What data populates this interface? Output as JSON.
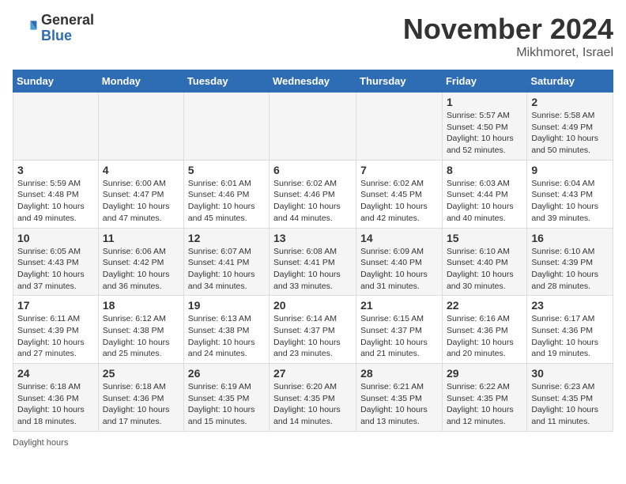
{
  "logo": {
    "general": "General",
    "blue": "Blue"
  },
  "header": {
    "month": "November 2024",
    "location": "Mikhmoret, Israel"
  },
  "days_of_week": [
    "Sunday",
    "Monday",
    "Tuesday",
    "Wednesday",
    "Thursday",
    "Friday",
    "Saturday"
  ],
  "weeks": [
    [
      {
        "day": "",
        "info": ""
      },
      {
        "day": "",
        "info": ""
      },
      {
        "day": "",
        "info": ""
      },
      {
        "day": "",
        "info": ""
      },
      {
        "day": "",
        "info": ""
      },
      {
        "day": "1",
        "info": "Sunrise: 5:57 AM\nSunset: 4:50 PM\nDaylight: 10 hours and 52 minutes."
      },
      {
        "day": "2",
        "info": "Sunrise: 5:58 AM\nSunset: 4:49 PM\nDaylight: 10 hours and 50 minutes."
      }
    ],
    [
      {
        "day": "3",
        "info": "Sunrise: 5:59 AM\nSunset: 4:48 PM\nDaylight: 10 hours and 49 minutes."
      },
      {
        "day": "4",
        "info": "Sunrise: 6:00 AM\nSunset: 4:47 PM\nDaylight: 10 hours and 47 minutes."
      },
      {
        "day": "5",
        "info": "Sunrise: 6:01 AM\nSunset: 4:46 PM\nDaylight: 10 hours and 45 minutes."
      },
      {
        "day": "6",
        "info": "Sunrise: 6:02 AM\nSunset: 4:46 PM\nDaylight: 10 hours and 44 minutes."
      },
      {
        "day": "7",
        "info": "Sunrise: 6:02 AM\nSunset: 4:45 PM\nDaylight: 10 hours and 42 minutes."
      },
      {
        "day": "8",
        "info": "Sunrise: 6:03 AM\nSunset: 4:44 PM\nDaylight: 10 hours and 40 minutes."
      },
      {
        "day": "9",
        "info": "Sunrise: 6:04 AM\nSunset: 4:43 PM\nDaylight: 10 hours and 39 minutes."
      }
    ],
    [
      {
        "day": "10",
        "info": "Sunrise: 6:05 AM\nSunset: 4:43 PM\nDaylight: 10 hours and 37 minutes."
      },
      {
        "day": "11",
        "info": "Sunrise: 6:06 AM\nSunset: 4:42 PM\nDaylight: 10 hours and 36 minutes."
      },
      {
        "day": "12",
        "info": "Sunrise: 6:07 AM\nSunset: 4:41 PM\nDaylight: 10 hours and 34 minutes."
      },
      {
        "day": "13",
        "info": "Sunrise: 6:08 AM\nSunset: 4:41 PM\nDaylight: 10 hours and 33 minutes."
      },
      {
        "day": "14",
        "info": "Sunrise: 6:09 AM\nSunset: 4:40 PM\nDaylight: 10 hours and 31 minutes."
      },
      {
        "day": "15",
        "info": "Sunrise: 6:10 AM\nSunset: 4:40 PM\nDaylight: 10 hours and 30 minutes."
      },
      {
        "day": "16",
        "info": "Sunrise: 6:10 AM\nSunset: 4:39 PM\nDaylight: 10 hours and 28 minutes."
      }
    ],
    [
      {
        "day": "17",
        "info": "Sunrise: 6:11 AM\nSunset: 4:39 PM\nDaylight: 10 hours and 27 minutes."
      },
      {
        "day": "18",
        "info": "Sunrise: 6:12 AM\nSunset: 4:38 PM\nDaylight: 10 hours and 25 minutes."
      },
      {
        "day": "19",
        "info": "Sunrise: 6:13 AM\nSunset: 4:38 PM\nDaylight: 10 hours and 24 minutes."
      },
      {
        "day": "20",
        "info": "Sunrise: 6:14 AM\nSunset: 4:37 PM\nDaylight: 10 hours and 23 minutes."
      },
      {
        "day": "21",
        "info": "Sunrise: 6:15 AM\nSunset: 4:37 PM\nDaylight: 10 hours and 21 minutes."
      },
      {
        "day": "22",
        "info": "Sunrise: 6:16 AM\nSunset: 4:36 PM\nDaylight: 10 hours and 20 minutes."
      },
      {
        "day": "23",
        "info": "Sunrise: 6:17 AM\nSunset: 4:36 PM\nDaylight: 10 hours and 19 minutes."
      }
    ],
    [
      {
        "day": "24",
        "info": "Sunrise: 6:18 AM\nSunset: 4:36 PM\nDaylight: 10 hours and 18 minutes."
      },
      {
        "day": "25",
        "info": "Sunrise: 6:18 AM\nSunset: 4:36 PM\nDaylight: 10 hours and 17 minutes."
      },
      {
        "day": "26",
        "info": "Sunrise: 6:19 AM\nSunset: 4:35 PM\nDaylight: 10 hours and 15 minutes."
      },
      {
        "day": "27",
        "info": "Sunrise: 6:20 AM\nSunset: 4:35 PM\nDaylight: 10 hours and 14 minutes."
      },
      {
        "day": "28",
        "info": "Sunrise: 6:21 AM\nSunset: 4:35 PM\nDaylight: 10 hours and 13 minutes."
      },
      {
        "day": "29",
        "info": "Sunrise: 6:22 AM\nSunset: 4:35 PM\nDaylight: 10 hours and 12 minutes."
      },
      {
        "day": "30",
        "info": "Sunrise: 6:23 AM\nSunset: 4:35 PM\nDaylight: 10 hours and 11 minutes."
      }
    ]
  ],
  "footer": {
    "daylight_label": "Daylight hours"
  }
}
